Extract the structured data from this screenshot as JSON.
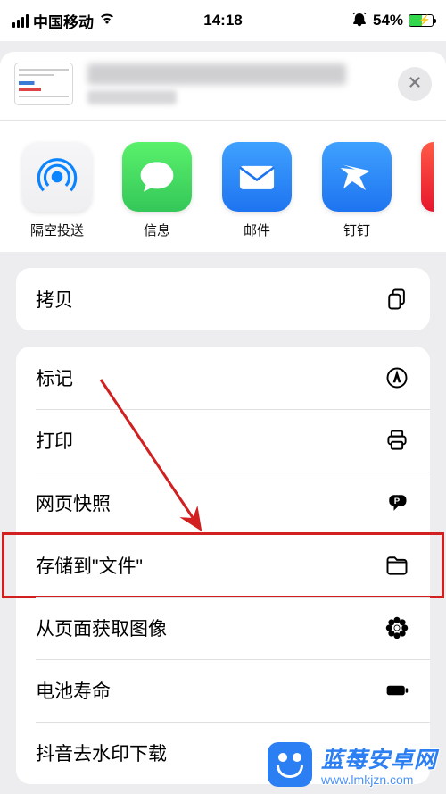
{
  "status": {
    "carrier": "中国移动",
    "time": "14:18",
    "battery_pct": "54%"
  },
  "share_apps": [
    {
      "key": "airdrop",
      "label": "隔空投送"
    },
    {
      "key": "messages",
      "label": "信息"
    },
    {
      "key": "mail",
      "label": "邮件"
    },
    {
      "key": "dingtalk",
      "label": "钉钉"
    }
  ],
  "actions": {
    "copy": "拷贝",
    "markup": "标记",
    "print": "打印",
    "web_snapshot": "网页快照",
    "save_to_files": "存储到\"文件\"",
    "get_images": "从页面获取图像",
    "battery_life": "电池寿命",
    "douyin_nowm": "抖音去水印下载"
  },
  "watermark": {
    "main": "蓝莓安卓网",
    "sub": "www.lmkjzn.com"
  }
}
